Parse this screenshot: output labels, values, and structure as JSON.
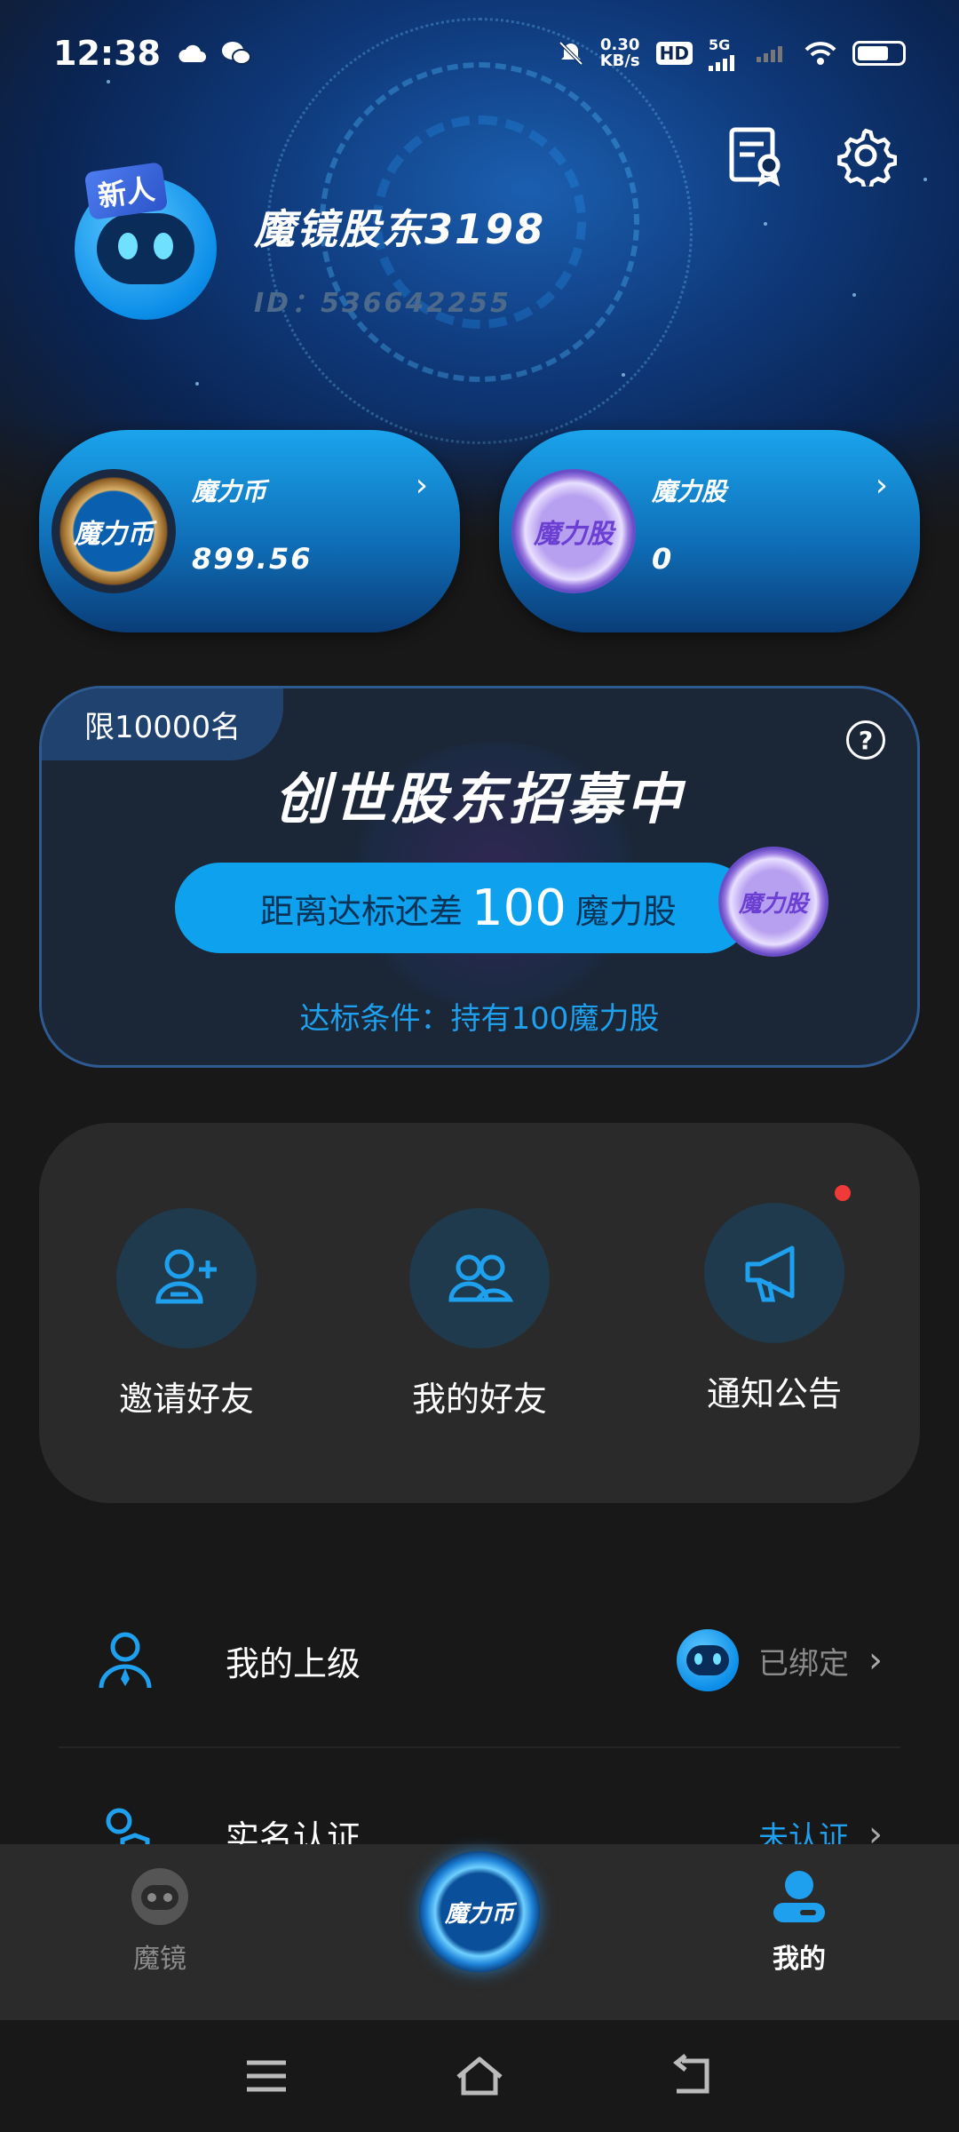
{
  "status_bar": {
    "time": "12:38",
    "speed_value": "0.30",
    "speed_unit": "KB/s",
    "hd_label": "HD",
    "network_label": "5G"
  },
  "profile": {
    "badge": "新人",
    "username": "魔镜股东3198",
    "user_id": "ID：536642255"
  },
  "cards": {
    "left": {
      "coin_label": "魔力币",
      "title": "魔力币",
      "value": "899.56"
    },
    "right": {
      "coin_label": "魔力股",
      "title": "魔力股",
      "value": "0"
    }
  },
  "recruit": {
    "tag": "限10000名",
    "title": "创世股东招募中",
    "progress_prefix": "距离达标还差",
    "progress_number": "100",
    "progress_suffix": "魔力股",
    "coin_label": "魔力股",
    "condition": "达标条件：持有100魔力股"
  },
  "actions": [
    {
      "label": "邀请好友",
      "icon": "add-user-icon"
    },
    {
      "label": "我的好友",
      "icon": "users-icon"
    },
    {
      "label": "通知公告",
      "icon": "megaphone-icon"
    }
  ],
  "list": [
    {
      "label": "我的上级",
      "status": "已绑定",
      "icon": "person-icon"
    },
    {
      "label": "实名认证",
      "status": "未认证",
      "icon": "shield-user-icon"
    }
  ],
  "tabbar": {
    "tabs": [
      {
        "label": "魔镜",
        "active": false
      },
      {
        "label": "魔力币",
        "active": false
      },
      {
        "label": "我的",
        "active": true
      }
    ]
  },
  "colors": {
    "accent": "#0ea1ee",
    "background": "#181818",
    "card_dark": "#2a2a2a",
    "notify_dot": "#f03a3a"
  }
}
